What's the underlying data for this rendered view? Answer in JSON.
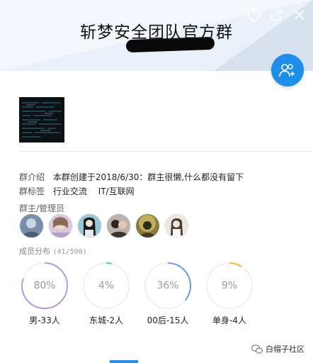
{
  "group": {
    "title": "斩梦安全团队官方群"
  },
  "intro": {
    "label": "群介绍",
    "text": "本群创建于2018/6/30：群主很懒,什么都没有留下"
  },
  "tags": {
    "label": "群标签",
    "items": [
      "行业交流",
      "IT/互联网"
    ]
  },
  "admins": {
    "label": "群主/管理员",
    "avatars": [
      "admin-avatar-1",
      "admin-avatar-2",
      "admin-avatar-3",
      "admin-avatar-4",
      "admin-avatar-5",
      "admin-avatar-6"
    ]
  },
  "distribution": {
    "label": "成员分布",
    "count": "(41/500)",
    "items": [
      {
        "pct": "80%",
        "value": 0.8,
        "caption": "男-33人",
        "color": "#b49bd8"
      },
      {
        "pct": "4%",
        "value": 0.04,
        "caption": "东城-2人",
        "color": "#5dc8b4"
      },
      {
        "pct": "36%",
        "value": 0.36,
        "caption": "00后-15人",
        "color": "#6b9be6"
      },
      {
        "pct": "9%",
        "value": 0.09,
        "caption": "单身-4人",
        "color": "#f2b63c"
      }
    ]
  },
  "icons": {
    "shield": "shield-icon",
    "share": "share-icon",
    "close": "close-icon",
    "add_members": "add-members-icon"
  },
  "watermark": "白帽子社区"
}
